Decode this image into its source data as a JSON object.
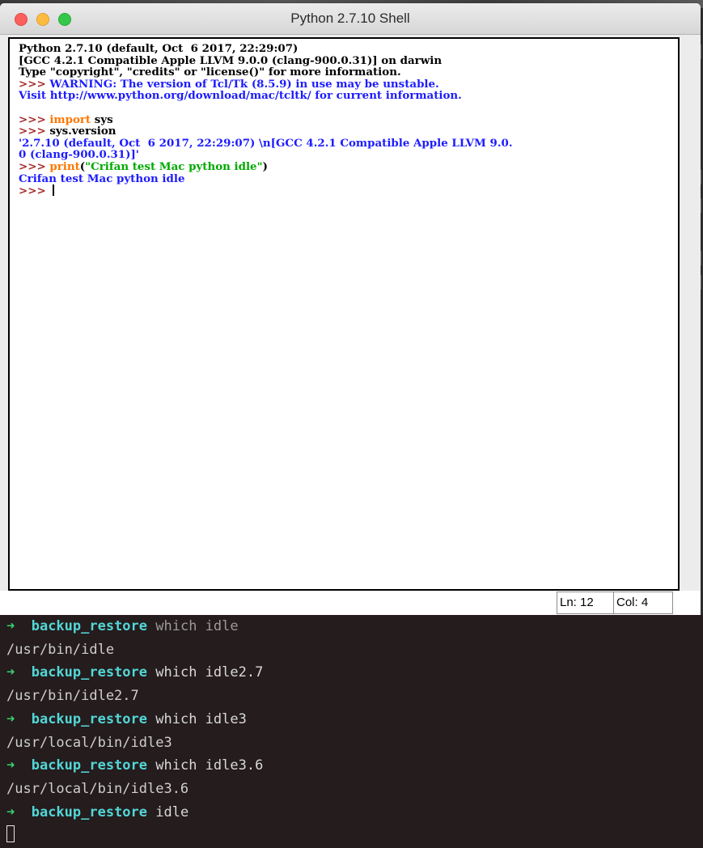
{
  "window": {
    "title": "Python 2.7.10 Shell",
    "traffic_lights": [
      "close-button",
      "minimize-button",
      "zoom-button"
    ]
  },
  "shell": {
    "lines": [
      [
        {
          "t": "Python 2.7.10 (default, Oct  6 2017, 22:29:07)",
          "c": "default"
        }
      ],
      [
        {
          "t": "[GCC 4.2.1 Compatible Apple LLVM 9.0.0 (clang-900.0.31)] on darwin",
          "c": "default"
        }
      ],
      [
        {
          "t": "Type \"copyright\", \"credits\" or \"license()\" for more information.",
          "c": "default"
        }
      ],
      [
        {
          "t": ">>> ",
          "c": "prompt"
        },
        {
          "t": "WARNING: The version of Tcl/Tk (8.5.9) in use may be unstable.",
          "c": "blue"
        }
      ],
      [
        {
          "t": "Visit http://www.python.org/download/mac/tcltk/ for current information.",
          "c": "blue"
        }
      ],
      [
        {
          "t": "",
          "c": "default"
        }
      ],
      [
        {
          "t": ">>> ",
          "c": "prompt"
        },
        {
          "t": "import",
          "c": "orange"
        },
        {
          "t": " sys",
          "c": "default"
        }
      ],
      [
        {
          "t": ">>> ",
          "c": "prompt"
        },
        {
          "t": "sys.version",
          "c": "default"
        }
      ],
      [
        {
          "t": "'2.7.10 (default, Oct  6 2017, 22:29:07) \\n[GCC 4.2.1 Compatible Apple LLVM 9.0.",
          "c": "blue"
        }
      ],
      [
        {
          "t": "0 (clang-900.0.31)]'",
          "c": "blue"
        }
      ],
      [
        {
          "t": ">>> ",
          "c": "prompt"
        },
        {
          "t": "print",
          "c": "orange"
        },
        {
          "t": "(",
          "c": "default"
        },
        {
          "t": "\"Crifan test Mac python idle\"",
          "c": "green"
        },
        {
          "t": ")",
          "c": "default"
        }
      ],
      [
        {
          "t": "Crifan test Mac python idle",
          "c": "blue"
        }
      ],
      [
        {
          "t": ">>> ",
          "c": "prompt"
        }
      ]
    ],
    "colors": {
      "default": "#000000",
      "prompt": "#a52a2a",
      "blue": "#1c1cff",
      "orange": "#ff7700",
      "green": "#00aa00"
    }
  },
  "status": {
    "line": "Ln: 12",
    "col": "Col: 4"
  },
  "terminal": {
    "prompt_arrow": "➜",
    "prompt_dir": "backup_restore",
    "entries": [
      {
        "type": "cmd",
        "text": "which idle",
        "dim": true
      },
      {
        "type": "out",
        "text": "/usr/bin/idle"
      },
      {
        "type": "cmd",
        "text": "which idle2.7",
        "dim": false
      },
      {
        "type": "out",
        "text": "/usr/bin/idle2.7"
      },
      {
        "type": "cmd",
        "text": "which idle3",
        "dim": false
      },
      {
        "type": "out",
        "text": "/usr/local/bin/idle3"
      },
      {
        "type": "cmd",
        "text": "which idle3.6",
        "dim": false
      },
      {
        "type": "out",
        "text": "/usr/local/bin/idle3.6"
      },
      {
        "type": "cmd",
        "text": "idle",
        "dim": false
      }
    ],
    "colors": {
      "arrow": "#39d36f",
      "dir": "#53d6d6",
      "text": "#d9d9d9",
      "background": "#241c1d"
    }
  }
}
